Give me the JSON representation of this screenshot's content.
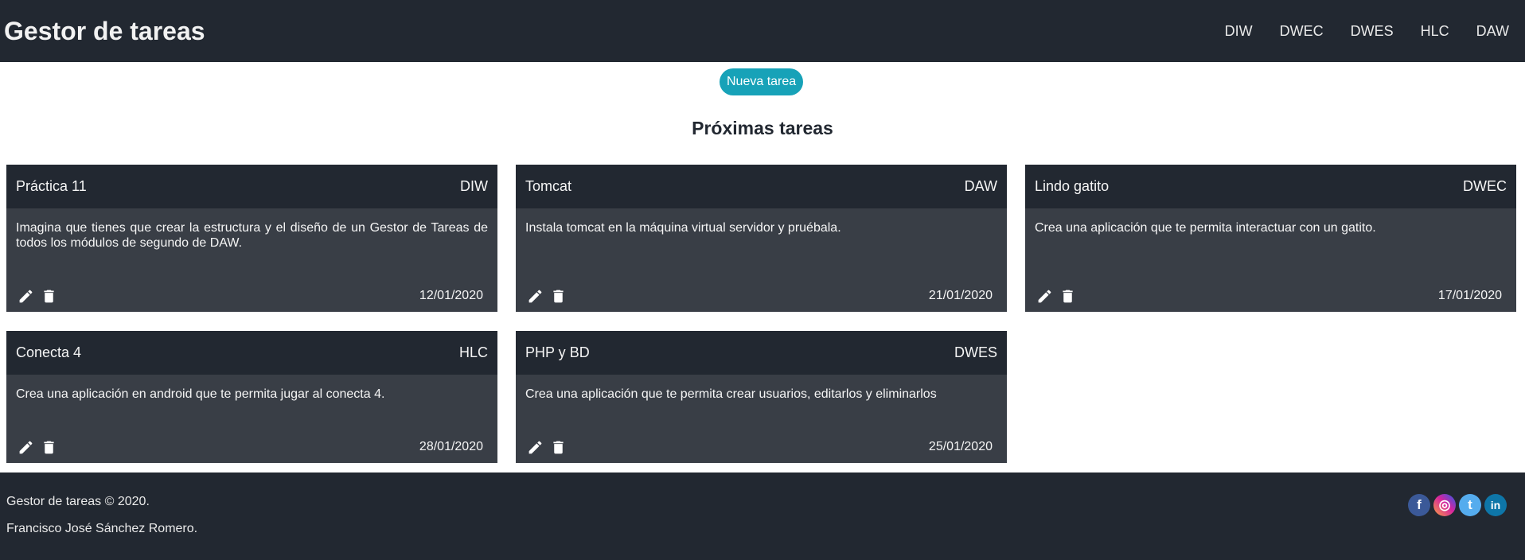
{
  "header": {
    "brand": "Gestor de tareas",
    "nav": [
      "DIW",
      "DWEC",
      "DWES",
      "HLC",
      "DAW"
    ]
  },
  "actions": {
    "new_task_label": "Nueva tarea"
  },
  "main": {
    "title": "Próximas tareas"
  },
  "tasks": [
    {
      "title": "Práctica 11",
      "module": "DIW",
      "description": "Imagina que tienes que crear la estructura y el diseño de un Gestor de Tareas de todos los módulos de segundo de DAW.",
      "date": "12/01/2020"
    },
    {
      "title": "Tomcat",
      "module": "DAW",
      "description": "Instala tomcat en la máquina virtual servidor y pruébala.",
      "date": "21/01/2020"
    },
    {
      "title": "Lindo gatito",
      "module": "DWEC",
      "description": "Crea una aplicación que te permita interactuar con un gatito.",
      "date": "17/01/2020"
    },
    {
      "title": "Conecta 4",
      "module": "HLC",
      "description": "Crea una aplicación en android que te permita jugar al conecta 4.",
      "date": "28/01/2020"
    },
    {
      "title": "PHP y BD",
      "module": "DWES",
      "description": "Crea una aplicación que te permita crear usuarios, editarlos y eliminarlos",
      "date": "25/01/2020"
    }
  ],
  "footer": {
    "copyright": "Gestor de tareas © 2020.",
    "author": "Francisco José Sánchez Romero.",
    "social": [
      {
        "icon": "facebook-icon",
        "glyph": "f"
      },
      {
        "icon": "instagram-icon",
        "glyph": "◎"
      },
      {
        "icon": "twitter-icon",
        "glyph": "t"
      },
      {
        "icon": "linkedin-icon",
        "glyph": "in"
      }
    ]
  },
  "colors": {
    "dark": "#222831",
    "card": "#393e46",
    "accent": "#17a2b8"
  }
}
